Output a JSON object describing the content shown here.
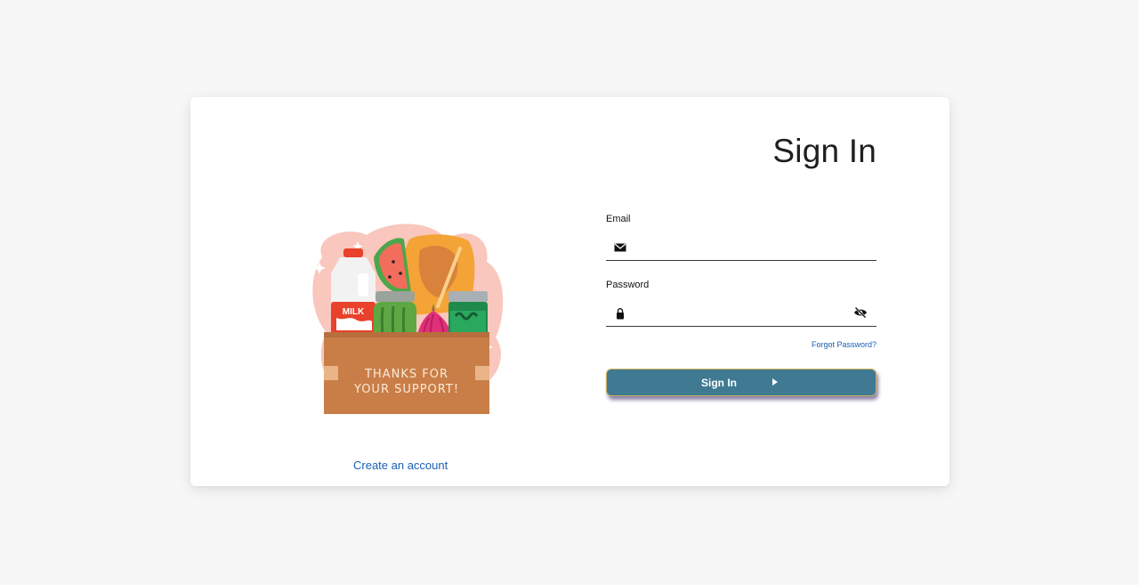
{
  "signin": {
    "title": "Sign In",
    "email": {
      "label": "Email",
      "value": "",
      "placeholder": ""
    },
    "password": {
      "label": "Password",
      "value": "",
      "placeholder": ""
    },
    "forgot_password": "Forgot Password?",
    "submit_label": "Sign In"
  },
  "illustration": {
    "milk_label": "MILK",
    "box_text_line1": "THANKS FOR",
    "box_text_line2": "YOUR SUPPORT!"
  },
  "create_account": "Create an account",
  "icons": {
    "email": "envelope-icon",
    "password": "lock-icon",
    "visibility": "eye-slash-icon",
    "submit": "play-arrow-icon"
  },
  "colors": {
    "background": "#f7f7f7",
    "card": "#ffffff",
    "button": "#3f7a92",
    "link": "#1a5fb4"
  }
}
